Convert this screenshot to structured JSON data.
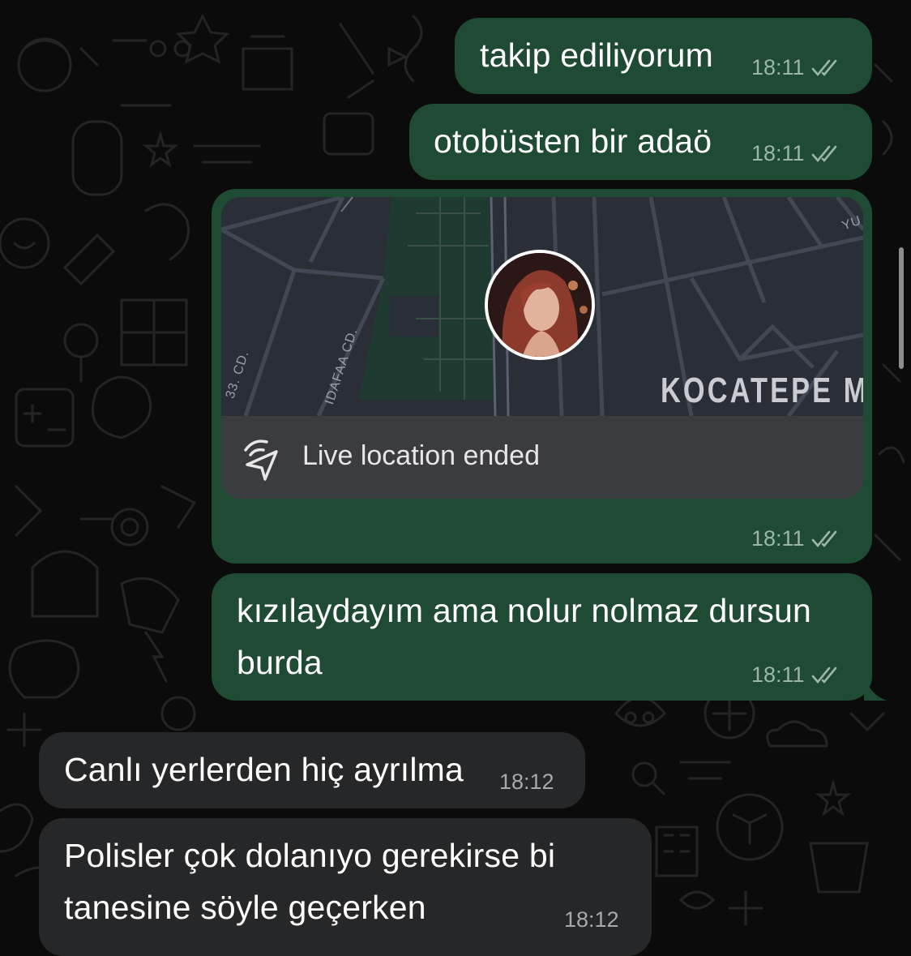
{
  "chat": {
    "messages": [
      {
        "direction": "outgoing",
        "text": "takip ediliyorum",
        "time": "18:11",
        "status": "read"
      },
      {
        "direction": "outgoing",
        "text": "otobüsten bir adaö",
        "time": "18:11",
        "status": "read"
      },
      {
        "direction": "outgoing",
        "type": "live-location",
        "time": "18:11",
        "status": "read",
        "map": {
          "area_label": "KOCATEPE M",
          "street_labels": [
            "33. CD.",
            "IDAFAA CD.",
            "YU"
          ]
        },
        "live_status": "Live location ended"
      },
      {
        "direction": "outgoing",
        "lines": [
          "kızılaydayım ama nolur nolmaz dursun",
          "burda"
        ],
        "time": "18:11",
        "status": "read"
      },
      {
        "direction": "incoming",
        "text": "Canlı yerlerden hiç ayrılma",
        "time": "18:12"
      },
      {
        "direction": "incoming",
        "lines": [
          "Polisler çok dolanıyo gerekirse bi",
          "tanesine söyle geçerken"
        ],
        "time": "18:12"
      }
    ]
  },
  "colors": {
    "background": "#0b0b0b",
    "outgoing_bubble": "#1f4a33",
    "incoming_bubble": "#262729",
    "map_background": "#2a2e36",
    "map_park": "#1f3a30"
  },
  "icons": {
    "read_receipt": "double-check-icon",
    "live_location": "live-location-icon"
  }
}
